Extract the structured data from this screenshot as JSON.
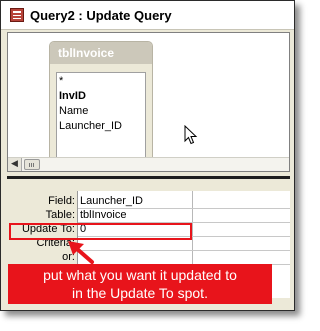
{
  "window": {
    "title": "Query2 : Update Query"
  },
  "table": {
    "name": "tblInvoice",
    "fields": [
      "*",
      "InvID",
      "Name",
      "Launcher_ID"
    ]
  },
  "grid": {
    "row_labels": [
      "Field:",
      "Table:",
      "Update To:",
      "Criteria:",
      "or:"
    ],
    "column1": {
      "field": "Launcher_ID",
      "table": "tblInvoice",
      "update_to": "0"
    }
  },
  "callout": {
    "line1": "put what you want it updated to",
    "line2": "in the Update To spot."
  },
  "colors": {
    "annotation": "#e8141b",
    "window_background": "#ece9d8"
  },
  "icons": [
    "query-window-icon",
    "mouse-pointer-icon",
    "scroll-left-icon"
  ]
}
